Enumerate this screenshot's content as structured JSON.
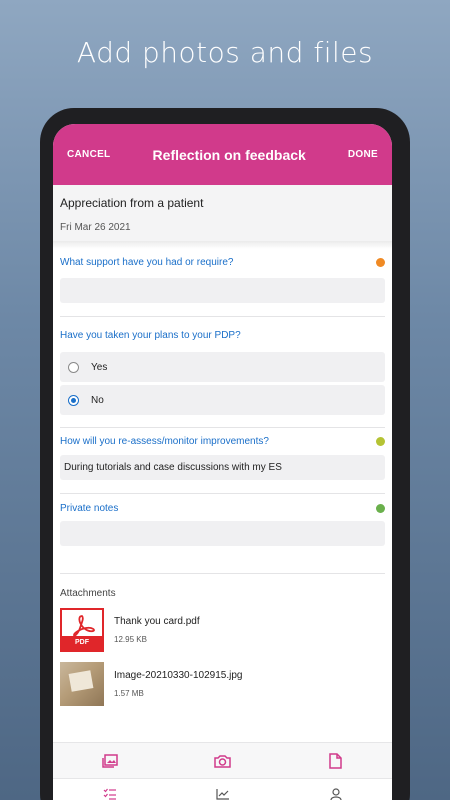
{
  "headline": "Add photos and files",
  "appbar": {
    "cancel": "CANCEL",
    "title": "Reflection on feedback",
    "done": "DONE",
    "color": "#d13a8b"
  },
  "entry": {
    "title": "Appreciation from a patient",
    "date": "Fri Mar 26 2021"
  },
  "questions": {
    "support": {
      "label": "What support have you had or require?",
      "answer": "",
      "dot_color": "#f08a24"
    },
    "pdp": {
      "label": "Have you taken your plans to your PDP?",
      "options": [
        "Yes",
        "No"
      ],
      "selected": "No"
    },
    "reassess": {
      "label": "How will you re-assess/monitor improvements?",
      "answer": "During tutorials and case discussions with my ES",
      "dot_color": "#b5c334"
    },
    "notes": {
      "label": "Private notes",
      "answer": "",
      "dot_color": "#6ab04c"
    }
  },
  "attachments": {
    "title": "Attachments",
    "items": [
      {
        "name": "Thank you card.pdf",
        "size": "12.95 KB",
        "type": "pdf",
        "badge": "PDF"
      },
      {
        "name": "Image-20210330-102915.jpg",
        "size": "1.57 MB",
        "type": "image"
      }
    ]
  },
  "toolbar": {
    "icons": [
      "gallery-icon",
      "camera-icon",
      "file-icon"
    ],
    "color": "#d13a8b"
  },
  "bottom_nav": {
    "icons": [
      "checklist-icon",
      "chart-icon",
      "profile-icon"
    ]
  }
}
